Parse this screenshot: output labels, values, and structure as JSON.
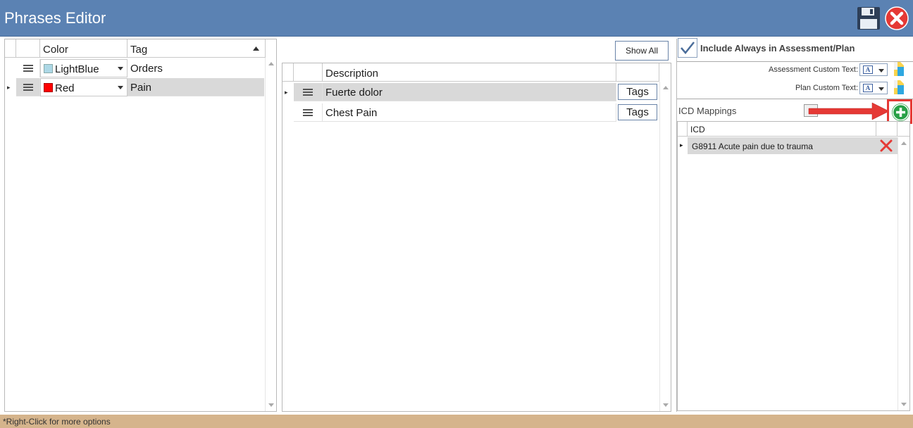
{
  "window": {
    "title": "Phrases Editor",
    "status_text": "*Right-Click for more options"
  },
  "tags_grid": {
    "columns": {
      "color": "Color",
      "tag": "Tag"
    },
    "rows": [
      {
        "color_name": "LightBlue",
        "color_hex": "#add8e6",
        "tag": "Orders",
        "selected": false
      },
      {
        "color_name": "Red",
        "color_hex": "#ff0000",
        "tag": "Pain",
        "selected": true
      }
    ]
  },
  "phrases_grid": {
    "show_all_label": "Show All",
    "columns": {
      "description": "Description"
    },
    "rows": [
      {
        "description": "Fuerte dolor",
        "tags_label": "Tags",
        "selected": true
      },
      {
        "description": "Chest Pain",
        "tags_label": "Tags",
        "selected": false
      }
    ]
  },
  "details": {
    "include_always_label": "Include Always in Assessment/Plan",
    "include_always_checked": true,
    "assessment_custom_text_label": "Assessment Custom Text:",
    "plan_custom_text_label": "Plan Custom Text:",
    "icd_mappings_label": "ICD Mappings",
    "icd_columns": {
      "icd": "ICD"
    },
    "icd_rows": [
      {
        "text": "G8911 Acute pain due to trauma"
      }
    ],
    "accent_color": "#e53935",
    "add_button_color": "#27a046"
  }
}
